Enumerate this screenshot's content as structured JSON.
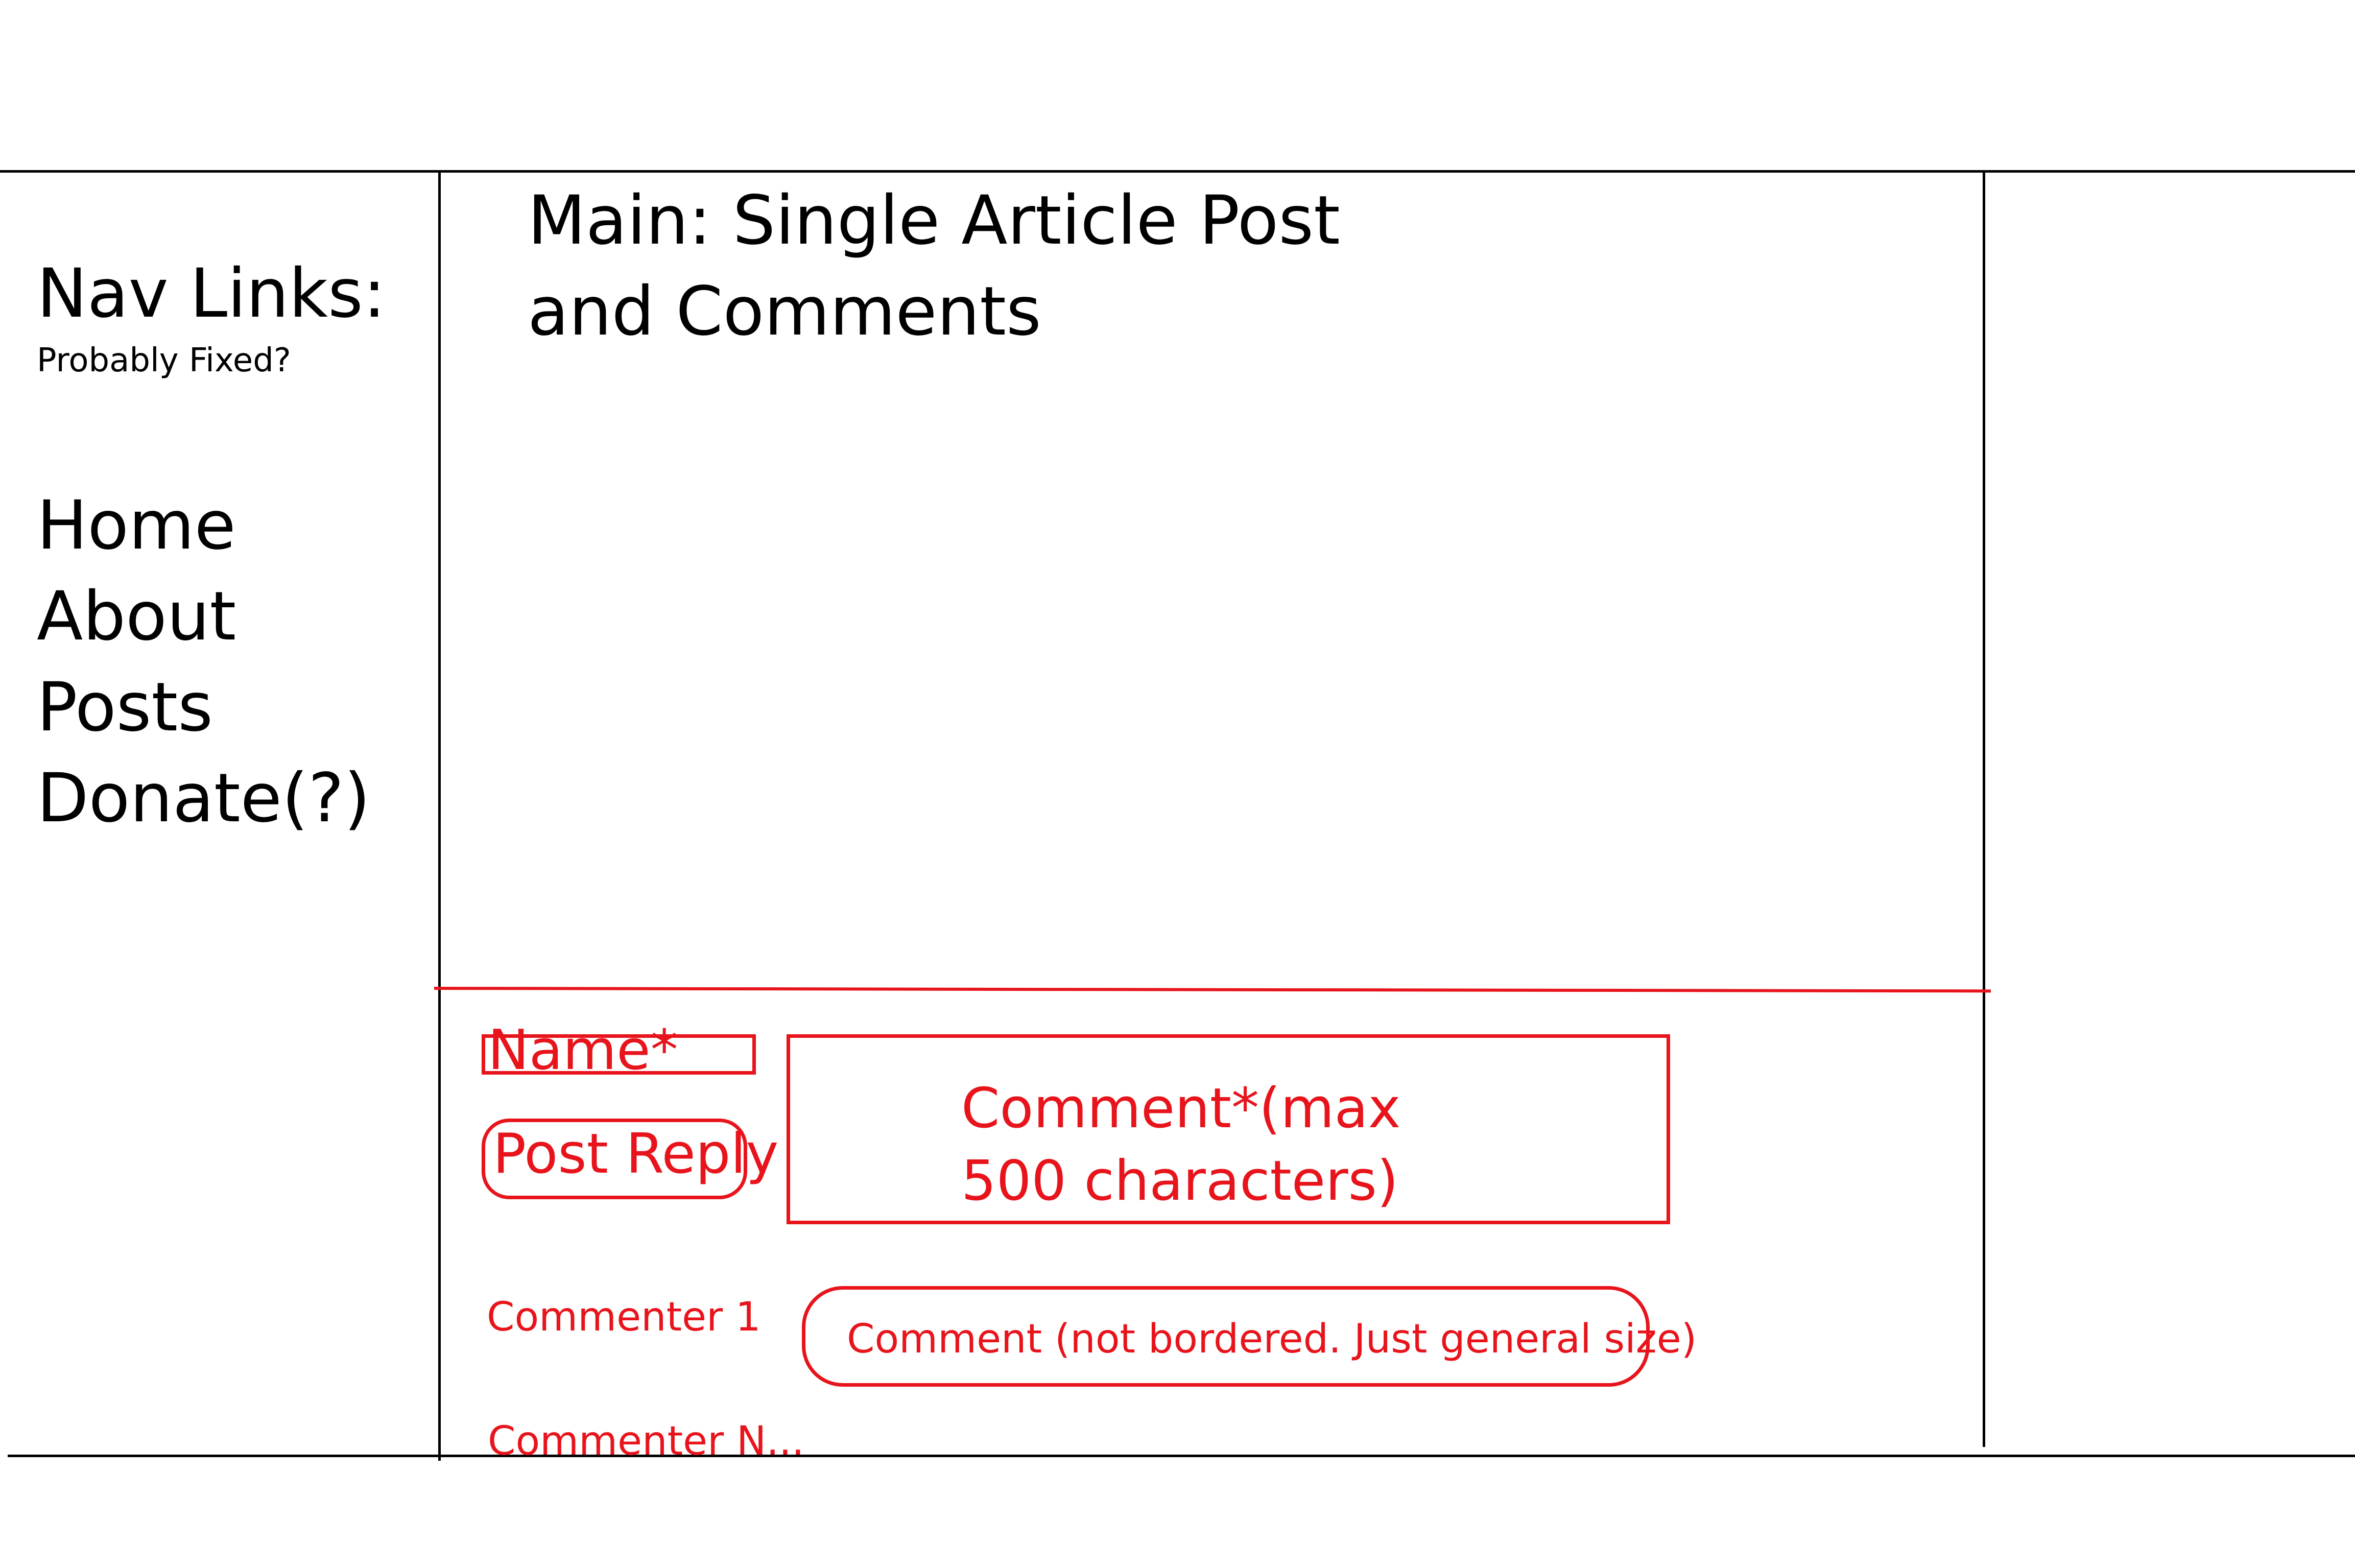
{
  "nav": {
    "heading": "Nav Links:",
    "subheading": "Probably Fixed?",
    "items": [
      {
        "label": "Home"
      },
      {
        "label": "About"
      },
      {
        "label": "Posts"
      },
      {
        "label": "Donate(?)"
      }
    ]
  },
  "main": {
    "title": "Main: Single Article Post\nand Comments"
  },
  "comment_form": {
    "name_label": "Name*",
    "post_reply_label": "Post Reply",
    "comment_label": "Comment*(max\n500 characters)"
  },
  "comments": {
    "first_commenter": "Commenter 1",
    "first_comment": "Comment (not bordered. Just general size)",
    "last_commenter": "Commenter N..."
  },
  "colors": {
    "sketch_black": "#000000",
    "annotation_red": "#e8141c"
  }
}
